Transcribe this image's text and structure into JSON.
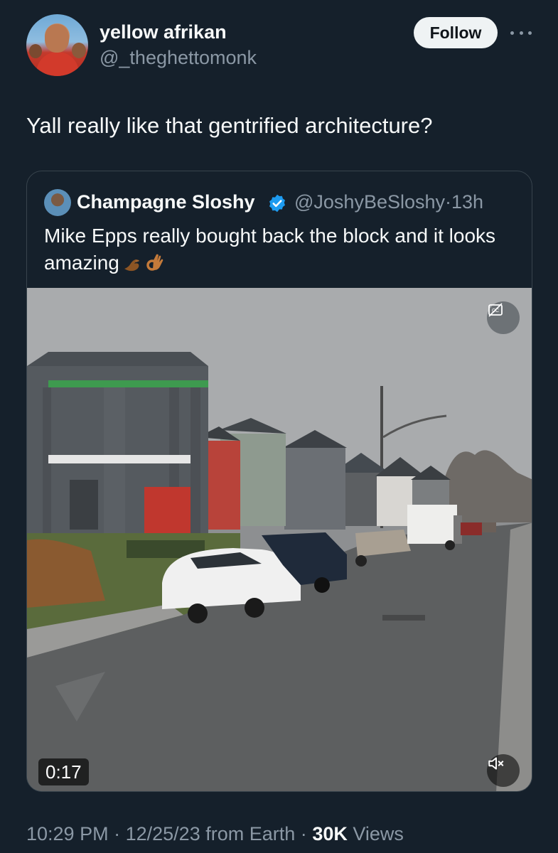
{
  "author": {
    "display_name": "yellow afrikan",
    "handle": "@_theghettomonk",
    "follow_label": "Follow"
  },
  "tweet": {
    "text": "Yall really like that gentrified architecture?"
  },
  "quoted": {
    "display_name": "Champagne Sloshy",
    "handle": "@JoshyBeSloshy",
    "separator": "·",
    "time": "13h",
    "text": "Mike Epps really bought back the block and it looks amazing",
    "emojis": [
      "pinching-hand-emoji",
      "ok-hand-emoji"
    ],
    "verified_color": "#1d9bf0",
    "video": {
      "duration": "0:17",
      "cc_icon": "captions-icon",
      "mute_icon": "muted-speaker-icon"
    }
  },
  "meta": {
    "time": "10:29 PM",
    "sep1": "·",
    "date": "12/25/23",
    "source": "from Earth",
    "sep2": "·",
    "views_count": "30K",
    "views_label": "Views"
  },
  "colors": {
    "background": "#15202b",
    "text_primary": "#f7f9f9",
    "text_secondary": "#8b98a5",
    "border": "#38444d"
  }
}
